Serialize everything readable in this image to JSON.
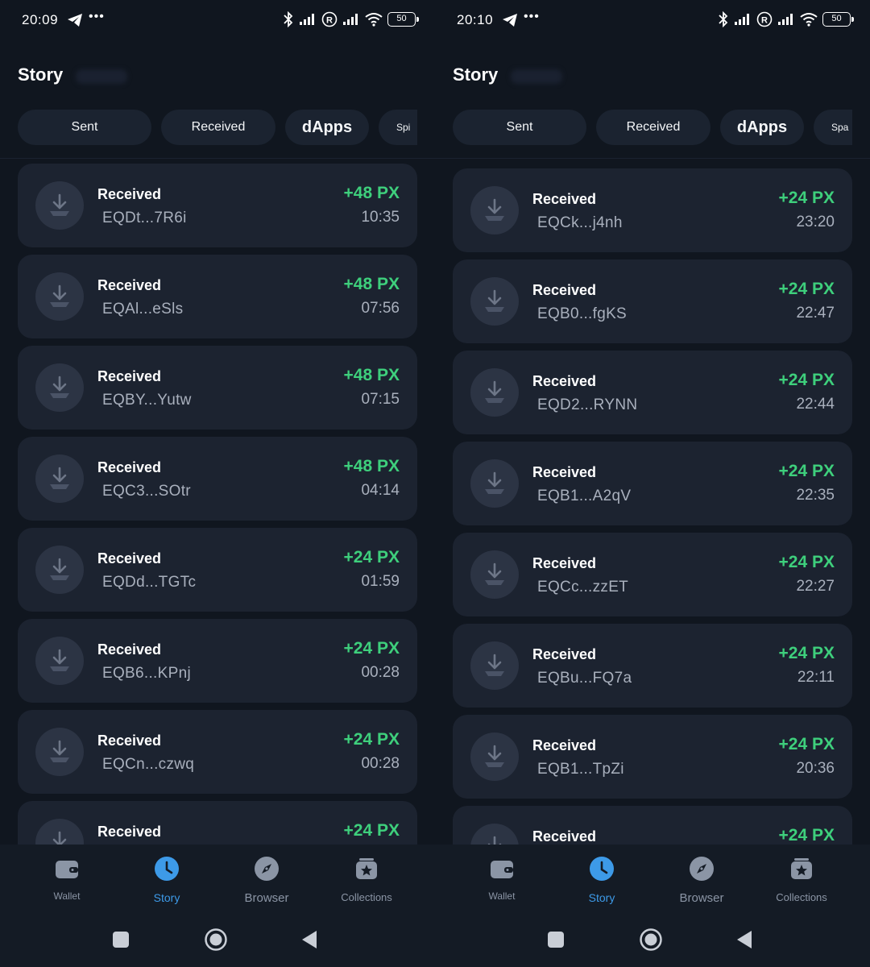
{
  "colors": {
    "background": "#10161f",
    "card": "#1c2330",
    "amount_positive": "#3ecf7c",
    "nav_active": "#3d9ae8",
    "secondary_text": "#a9b0bd"
  },
  "screens": [
    {
      "status": {
        "time": "20:09",
        "battery": "50"
      },
      "title": "Story",
      "tabs": [
        {
          "label": "Sent"
        },
        {
          "label": "Received"
        },
        {
          "label": "dApps"
        },
        {
          "label": "Spi"
        }
      ],
      "transactions": [
        {
          "title": "Received",
          "address": "EQDt...7R6i",
          "amount": "+48 PX",
          "time": "10:35",
          "icon": "download-icon"
        },
        {
          "title": "Received",
          "address": "EQAl...eSls",
          "amount": "+48 PX",
          "time": "07:56",
          "icon": "download-icon"
        },
        {
          "title": "Received",
          "address": "EQBY...Yutw",
          "amount": "+48 PX",
          "time": "07:15",
          "icon": "download-icon"
        },
        {
          "title": "Received",
          "address": "EQC3...SOtr",
          "amount": "+48 PX",
          "time": "04:14",
          "icon": "download-icon"
        },
        {
          "title": "Received",
          "address": "EQDd...TGTc",
          "amount": "+24 PX",
          "time": "01:59",
          "icon": "download-icon"
        },
        {
          "title": "Received",
          "address": "EQB6...KPnj",
          "amount": "+24 PX",
          "time": "00:28",
          "icon": "download-icon"
        },
        {
          "title": "Received",
          "address": "EQCn...czwq",
          "amount": "+24 PX",
          "time": "00:28",
          "icon": "download-icon"
        },
        {
          "title": "Received",
          "address": "",
          "amount": "+24 PX",
          "time": "",
          "icon": "download-icon"
        }
      ],
      "nav": [
        {
          "label": "Wallet",
          "icon": "wallet-icon",
          "active": false
        },
        {
          "label": "Story",
          "icon": "clock-icon",
          "active": true
        },
        {
          "label": "Browser",
          "icon": "compass-icon",
          "active": false
        },
        {
          "label": "Collections",
          "icon": "star-icon",
          "active": false
        }
      ]
    },
    {
      "status": {
        "time": "20:10",
        "battery": "50"
      },
      "title": "Story",
      "tabs": [
        {
          "label": "Sent"
        },
        {
          "label": "Received"
        },
        {
          "label": "dApps"
        },
        {
          "label": "Spa"
        }
      ],
      "transactions": [
        {
          "title": "Received",
          "address": "EQCk...j4nh",
          "amount": "+24 PX",
          "time": "23:20",
          "icon": "download-icon"
        },
        {
          "title": "Received",
          "address": "EQB0...fgKS",
          "amount": "+24 PX",
          "time": "22:47",
          "icon": "download-icon"
        },
        {
          "title": "Received",
          "address": "EQD2...RYNN",
          "amount": "+24 PX",
          "time": "22:44",
          "icon": "download-icon"
        },
        {
          "title": "Received",
          "address": "EQB1...A2qV",
          "amount": "+24 PX",
          "time": "22:35",
          "icon": "download-icon"
        },
        {
          "title": "Received",
          "address": "EQCc...zzET",
          "amount": "+24 PX",
          "time": "22:27",
          "icon": "download-icon"
        },
        {
          "title": "Received",
          "address": "EQBu...FQ7a",
          "amount": "+24 PX",
          "time": "22:11",
          "icon": "download-icon"
        },
        {
          "title": "Received",
          "address": "EQB1...TpZi",
          "amount": "+24 PX",
          "time": "20:36",
          "icon": "download-icon"
        },
        {
          "title": "Received",
          "address": "",
          "amount": "+24 PX",
          "time": "",
          "icon": "download-icon"
        }
      ],
      "nav": [
        {
          "label": "Wallet",
          "icon": "wallet-icon",
          "active": false
        },
        {
          "label": "Story",
          "icon": "clock-icon",
          "active": true
        },
        {
          "label": "Browser",
          "icon": "compass-icon",
          "active": false
        },
        {
          "label": "Collections",
          "icon": "star-icon",
          "active": false
        }
      ]
    }
  ]
}
